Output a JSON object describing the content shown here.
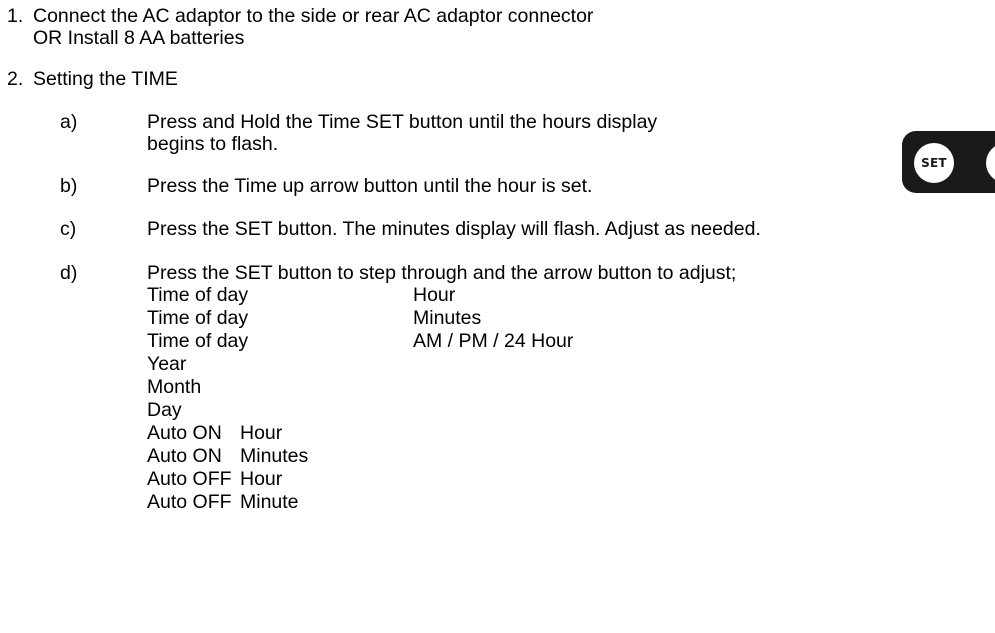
{
  "step1": {
    "num": "1.",
    "line1": "Connect the AC adaptor to the side or rear AC adaptor connector",
    "line2": "OR Install 8 AA batteries"
  },
  "step2": {
    "num": "2.",
    "title": "Setting the TIME",
    "a": {
      "label": "a)",
      "line1": "Press and Hold the Time SET button until the hours display",
      "line2": "begins to flash."
    },
    "b": {
      "label": "b)",
      "text": "Press the Time up arrow button until the hour is set."
    },
    "c": {
      "label": "c)",
      "text": "Press the SET button. The minutes display will flash. Adjust as needed."
    },
    "d": {
      "label": "d)",
      "text": "Press the SET button to step through and the arrow button to adjust;",
      "rows": [
        {
          "c1": "Time of day",
          "c2": "Hour"
        },
        {
          "c1": "Time of day",
          "c2": "Minutes"
        },
        {
          "c1": "Time of day",
          "c2": "AM / PM / 24 Hour"
        },
        {
          "c1": "Year",
          "c2": ""
        },
        {
          "c1": "Month",
          "c2": ""
        },
        {
          "c1": "Day",
          "c2": ""
        },
        {
          "c1": "Auto ON",
          "c2": "Hour"
        },
        {
          "c1": "Auto ON",
          "c2": "Minutes"
        },
        {
          "c1": "Auto OFF",
          "c2": "Hour"
        },
        {
          "c1": "Auto OFF",
          "c2": "Minute"
        }
      ]
    }
  },
  "button_icon": {
    "label": "SET",
    "icon": "set-button-icon"
  }
}
